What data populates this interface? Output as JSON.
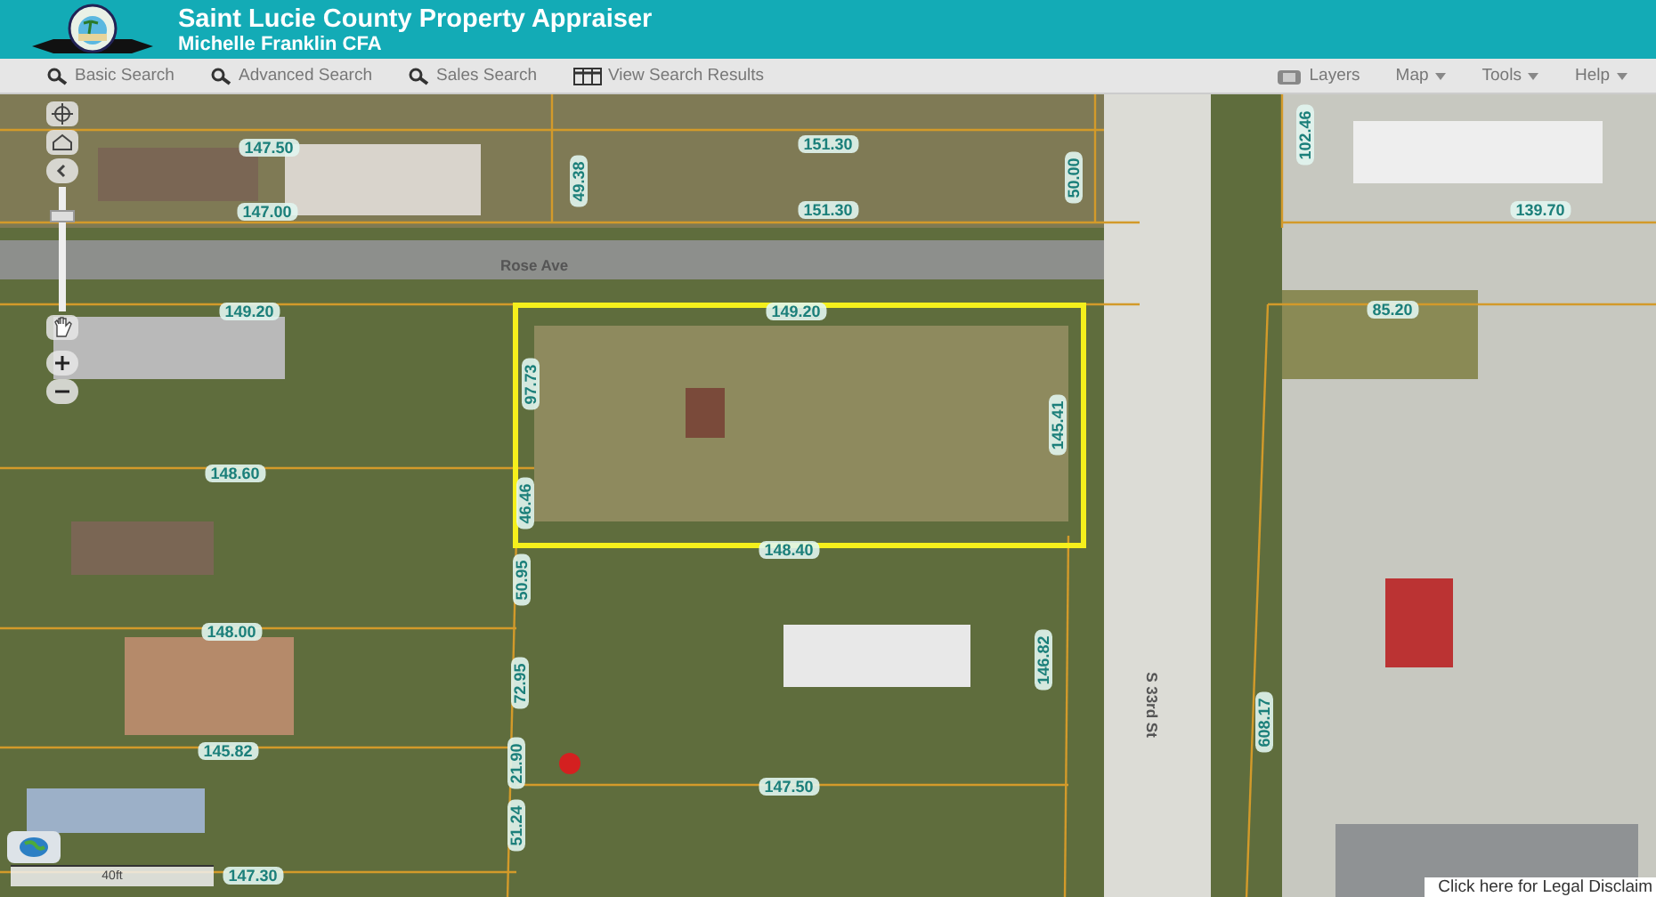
{
  "header": {
    "title": "Saint Lucie County Property Appraiser",
    "subtitle": "Michelle Franklin CFA"
  },
  "toolbar": {
    "left": [
      {
        "label": "Basic Search",
        "kind": "search"
      },
      {
        "label": "Advanced Search",
        "kind": "search"
      },
      {
        "label": "Sales Search",
        "kind": "search"
      },
      {
        "label": "View Search Results",
        "kind": "results"
      }
    ],
    "right": [
      {
        "label": "Layers",
        "kind": "layers"
      },
      {
        "label": "Map",
        "kind": "menu"
      },
      {
        "label": "Tools",
        "kind": "menu"
      },
      {
        "label": "Help",
        "kind": "menu"
      }
    ]
  },
  "map": {
    "zoom_slider": {
      "level": 0.8
    },
    "labels": [
      {
        "text": "147.50",
        "kind": "horizontal"
      },
      {
        "text": "151.30",
        "kind": "horizontal"
      },
      {
        "text": "147.00",
        "kind": "horizontal"
      },
      {
        "text": "151.30",
        "kind": "horizontal"
      },
      {
        "text": "49.38",
        "kind": "vertical"
      },
      {
        "text": "50.00",
        "kind": "vertical"
      },
      {
        "text": "102.46",
        "kind": "vertical"
      },
      {
        "text": "139.70",
        "kind": "horizontal"
      },
      {
        "text": "Rose Ave",
        "kind": "street"
      },
      {
        "text": "149.20",
        "kind": "horizontal"
      },
      {
        "text": "149.20",
        "kind": "horizontal"
      },
      {
        "text": "85.20",
        "kind": "horizontal"
      },
      {
        "text": "97.73",
        "kind": "vertical"
      },
      {
        "text": "145.41",
        "kind": "vertical"
      },
      {
        "text": "46.46",
        "kind": "vertical"
      },
      {
        "text": "148.60",
        "kind": "horizontal"
      },
      {
        "text": "148.40",
        "kind": "horizontal"
      },
      {
        "text": "50.95",
        "kind": "vertical"
      },
      {
        "text": "148.00",
        "kind": "horizontal"
      },
      {
        "text": "72.95",
        "kind": "vertical"
      },
      {
        "text": "146.82",
        "kind": "vertical"
      },
      {
        "text": "S 33rd St",
        "kind": "street-vertical"
      },
      {
        "text": "608.17",
        "kind": "vertical"
      },
      {
        "text": "145.82",
        "kind": "horizontal"
      },
      {
        "text": "21.90",
        "kind": "vertical"
      },
      {
        "text": "147.50",
        "kind": "horizontal"
      },
      {
        "text": "51.24",
        "kind": "vertical"
      },
      {
        "text": "147.30",
        "kind": "horizontal"
      }
    ],
    "scale": "40ft",
    "disclaimer": "Click here for Legal Disclaim"
  }
}
